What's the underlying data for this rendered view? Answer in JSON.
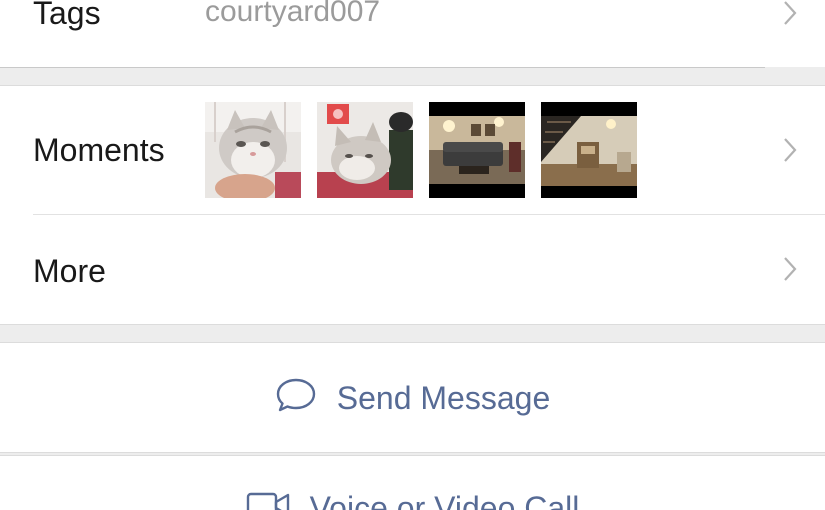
{
  "tags": {
    "label": "Tags",
    "value": "courtyard007"
  },
  "moments": {
    "label": "Moments",
    "thumbnails": [
      {
        "icon": "cat-photo"
      },
      {
        "icon": "cat-photo"
      },
      {
        "icon": "living-room-photo"
      },
      {
        "icon": "stairs-room-photo"
      }
    ]
  },
  "more": {
    "label": "More"
  },
  "actions": {
    "send_message": "Send Message",
    "call": "Voice or Video Call"
  },
  "colors": {
    "accent": "#576b95",
    "muted": "#9b9b9b",
    "background": "#ededed"
  }
}
